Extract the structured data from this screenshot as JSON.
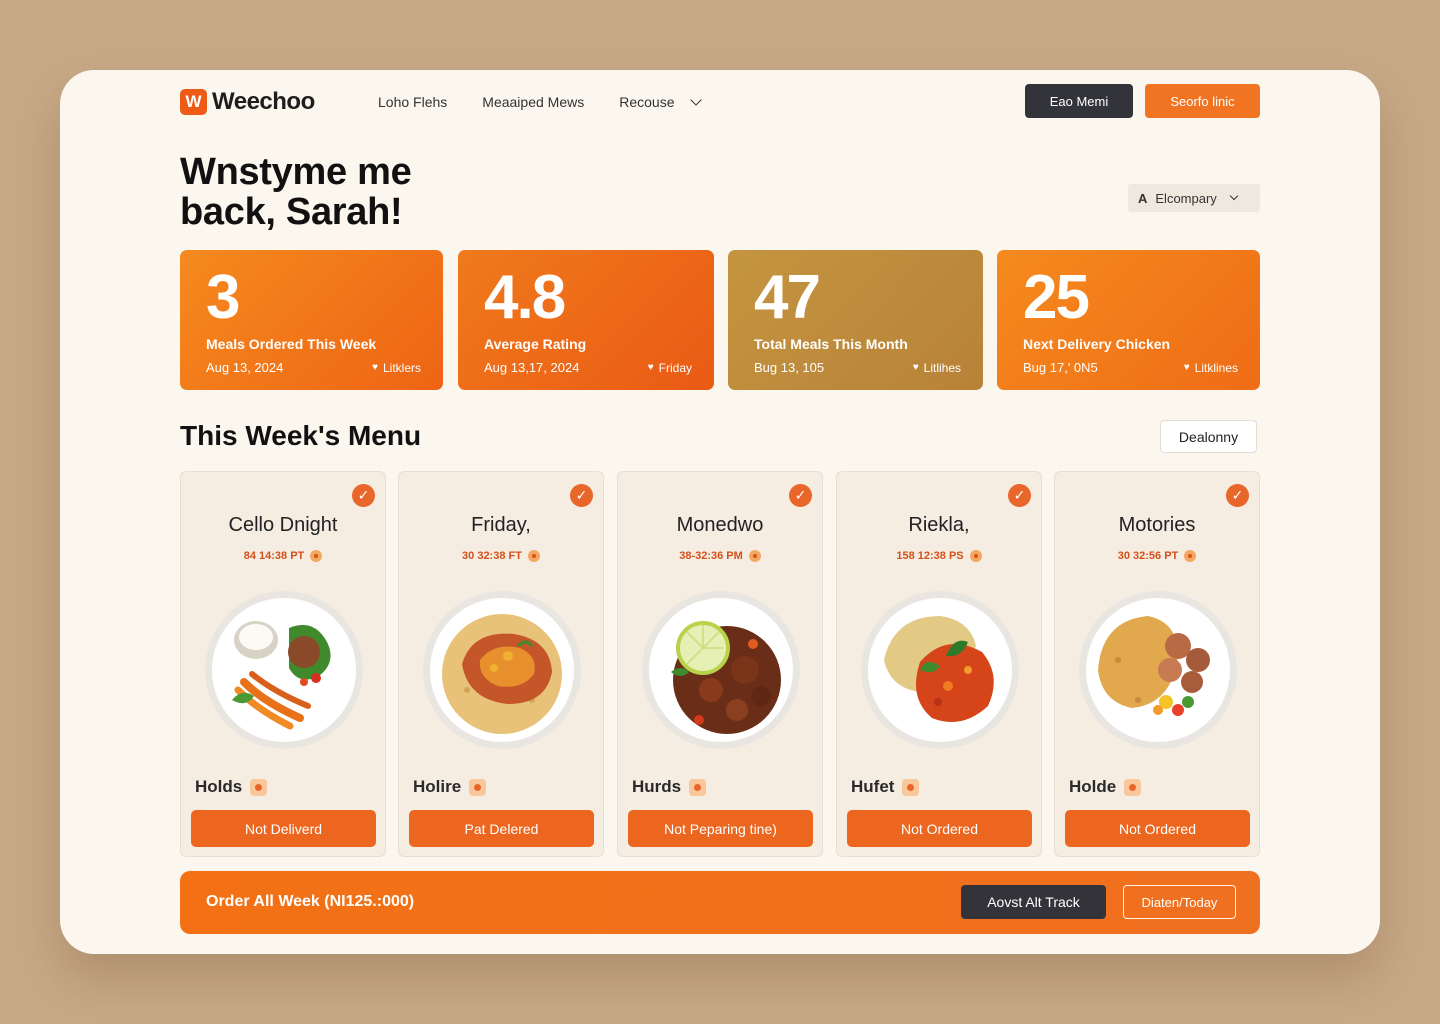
{
  "app": {
    "brand_mark": "W",
    "brand_name": "Weechoo",
    "nav": [
      "Loho Flehs",
      "Meaaiped Mews",
      "Recouse"
    ],
    "header_buttons": {
      "dark": "Eao Memi",
      "orange": "Seorfo linic"
    },
    "colors": {
      "accent": "#ef6a1c",
      "dark": "#33333a",
      "background": "#fbf6ee"
    }
  },
  "greeting": {
    "line1": "Wnstyme me",
    "line2": "back, Sarah!"
  },
  "view_select": {
    "prefix": "A",
    "value": "Elcompary"
  },
  "stats": [
    {
      "value": "3",
      "label": "Meals Ordered This Week",
      "date": "Aug 13, 2024",
      "tag": "Litklers"
    },
    {
      "value": "4.8",
      "label": "Average Rating",
      "date": "Aug 13,17, 2024",
      "tag": "Friday"
    },
    {
      "value": "47",
      "label": "Total Meals This Month",
      "date": "Bug 13, 105",
      "tag": "Litlihes"
    },
    {
      "value": "25",
      "label": "Next Delivery Chicken",
      "date": "Bug 17,' 0N5",
      "tag": "Litklines"
    }
  ],
  "menu": {
    "title": "This Week's Menu",
    "button": "Dealonny",
    "meals": [
      {
        "name": "Cello Dnight",
        "time": "84 14:38 PT",
        "tag": "Holds",
        "button": "Not Deliverd",
        "dish": "salad"
      },
      {
        "name": "Friday,",
        "time": "30 32:38 FT",
        "tag": "Holire",
        "button": "Pat Delered",
        "dish": "chicken-rice"
      },
      {
        "name": "Monedwo",
        "time": "38-32:36 PM",
        "tag": "Hurds",
        "button": "Not Peparing tine)",
        "dish": "beef-lime"
      },
      {
        "name": "Riekla,",
        "time": "158 12:38 PS",
        "tag": "Hufet",
        "button": "Not Ordered",
        "dish": "rice-stew"
      },
      {
        "name": "Motories",
        "time": "30 32:56 PT",
        "tag": "Holde",
        "button": "Not Ordered",
        "dish": "rice-chicken"
      }
    ]
  },
  "footer": {
    "text": "Order All Week (NI125.:000)",
    "dark_button": "Aovst Alt Track",
    "outline_button": "Diaten/Today"
  }
}
